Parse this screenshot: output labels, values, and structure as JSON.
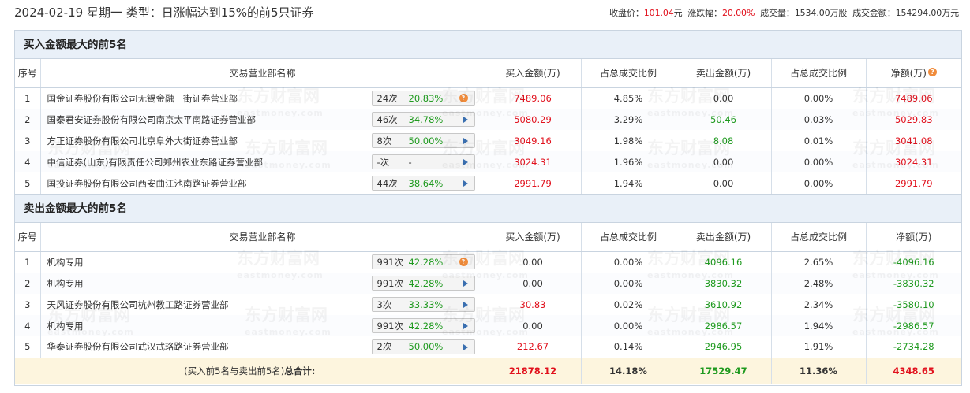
{
  "header": {
    "title": "2024-02-19 星期一 类型：日涨幅达到15%的前5只证券",
    "close_label": "收盘价：",
    "close_value": "101.04",
    "close_unit": "元",
    "change_label": "涨跌幅：",
    "change_value": "20.00%",
    "volume_label": "成交量：",
    "volume_value": "1534.00万股",
    "turnover_label": "成交金额：",
    "turnover_value": "154294.00万元"
  },
  "watermark": {
    "text": "东方财富网",
    "sub": "eastmoney.com"
  },
  "columns": {
    "seq": "序号",
    "name": "交易营业部名称",
    "buy": "买入金额(万)",
    "buy_pct": "占总成交比例",
    "sell": "卖出金额(万)",
    "sell_pct": "占总成交比例",
    "net": "净额(万)",
    "net_icon": "?"
  },
  "buy_section": {
    "title": "买入金额最大的前5名",
    "rows": [
      {
        "seq": "1",
        "name": "国金证券股份有限公司无锡金融一街证券营业部",
        "times": "24次",
        "rate": "20.83%",
        "icon": "question-icon",
        "buy": "7489.06",
        "buy_pct": "4.85%",
        "sell": "0.00",
        "sell_pct": "0.00%",
        "net": "7489.06"
      },
      {
        "seq": "2",
        "name": "国泰君安证券股份有限公司南京太平南路证券营业部",
        "times": "46次",
        "rate": "34.78%",
        "icon": "arrow-right-icon",
        "buy": "5080.29",
        "buy_pct": "3.29%",
        "sell": "50.46",
        "sell_pct": "0.03%",
        "net": "5029.83"
      },
      {
        "seq": "3",
        "name": "方正证券股份有限公司北京阜外大街证券营业部",
        "times": "8次",
        "rate": "50.00%",
        "icon": "arrow-right-icon",
        "buy": "3049.16",
        "buy_pct": "1.98%",
        "sell": "8.08",
        "sell_pct": "0.01%",
        "net": "3041.08"
      },
      {
        "seq": "4",
        "name": "中信证券(山东)有限责任公司郑州农业东路证券营业部",
        "times": "-次",
        "rate": "-",
        "icon": "arrow-right-icon",
        "buy": "3024.31",
        "buy_pct": "1.96%",
        "sell": "0.00",
        "sell_pct": "0.00%",
        "net": "3024.31"
      },
      {
        "seq": "5",
        "name": "国投证券股份有限公司西安曲江池南路证券营业部",
        "times": "44次",
        "rate": "38.64%",
        "icon": "arrow-right-icon",
        "buy": "2991.79",
        "buy_pct": "1.94%",
        "sell": "0.00",
        "sell_pct": "0.00%",
        "net": "2991.79"
      }
    ]
  },
  "sell_section": {
    "title": "卖出金额最大的前5名",
    "rows": [
      {
        "seq": "1",
        "name": "机构专用",
        "times": "991次",
        "rate": "42.28%",
        "icon": "question-icon",
        "buy": "0.00",
        "buy_pct": "0.00%",
        "sell": "4096.16",
        "sell_pct": "2.65%",
        "net": "-4096.16"
      },
      {
        "seq": "2",
        "name": "机构专用",
        "times": "991次",
        "rate": "42.28%",
        "icon": "arrow-right-icon",
        "buy": "0.00",
        "buy_pct": "0.00%",
        "sell": "3830.32",
        "sell_pct": "2.48%",
        "net": "-3830.32"
      },
      {
        "seq": "3",
        "name": "天风证券股份有限公司杭州教工路证券营业部",
        "times": "3次",
        "rate": "33.33%",
        "icon": "arrow-right-icon",
        "buy": "30.83",
        "buy_pct": "0.02%",
        "sell": "3610.92",
        "sell_pct": "2.34%",
        "net": "-3580.10"
      },
      {
        "seq": "4",
        "name": "机构专用",
        "times": "991次",
        "rate": "42.28%",
        "icon": "arrow-right-icon",
        "buy": "0.00",
        "buy_pct": "0.00%",
        "sell": "2986.57",
        "sell_pct": "1.94%",
        "net": "-2986.57"
      },
      {
        "seq": "5",
        "name": "华泰证券股份有限公司武汉武珞路证券营业部",
        "times": "2次",
        "rate": "50.00%",
        "icon": "arrow-right-icon",
        "buy": "212.67",
        "buy_pct": "0.14%",
        "sell": "2946.95",
        "sell_pct": "1.91%",
        "net": "-2734.28"
      }
    ],
    "total": {
      "label_prefix": "(买入前5名与卖出前5名)",
      "label_bold": "总合计:",
      "buy": "21878.12",
      "buy_pct": "14.18%",
      "sell": "17529.47",
      "sell_pct": "11.36%",
      "net": "4348.65"
    }
  },
  "colors": {
    "up": "#e1111d",
    "down": "#1f9a1f",
    "header_bg": "#e9f0f8",
    "total_bg": "#fdf5de"
  }
}
